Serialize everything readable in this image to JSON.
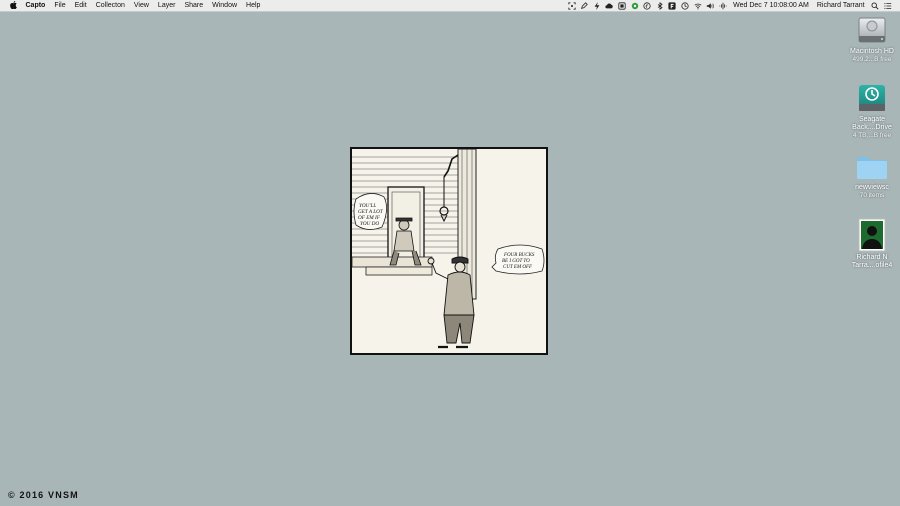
{
  "menubar": {
    "apple_icon": "apple-logo-icon",
    "app_name": "Capto",
    "items": [
      "File",
      "Edit",
      "Collecton",
      "View",
      "Layer",
      "Share",
      "Window",
      "Help"
    ],
    "status_icons": [
      "screen-capture-icon",
      "pen-icon",
      "bolt-icon",
      "creative-cloud-icon",
      "capto-icon",
      "green-dot-icon",
      "copyright-icon",
      "bluetooth-icon",
      "f-app-icon",
      "time-machine-icon",
      "wifi-icon",
      "volume-icon",
      "audio-icon"
    ],
    "clock": "Wed Dec 7  10:08:00 AM",
    "user": "Richard Tarrant",
    "spotlight_icon": "spotlight-search-icon",
    "notification_icon": "notification-center-icon"
  },
  "desktop": {
    "icons": [
      {
        "name": "Macintosh HD",
        "name2": "",
        "info": "499.2...B free",
        "icon": "hard-drive-icon"
      },
      {
        "name": "Seagate",
        "name2": "Back....Drive",
        "info": "4 TB,...B free",
        "icon": "time-machine-drive-icon"
      },
      {
        "name": "newviewsc",
        "name2": "",
        "info": "70 items",
        "icon": "folder-icon"
      },
      {
        "name": "Richard N",
        "name2": "Tarra....ofile4",
        "info": "",
        "icon": "image-file-icon"
      }
    ]
  },
  "artwork": {
    "bubble_left": [
      "YOU'LL",
      "GET A LOT",
      "OF EM IF",
      "YOU DO"
    ],
    "bubble_right": [
      "FOUR BUCKS",
      "BE I GOT TO",
      "CUT EM OFF"
    ]
  },
  "footer": {
    "copyright": "© 2016 VNSM"
  }
}
